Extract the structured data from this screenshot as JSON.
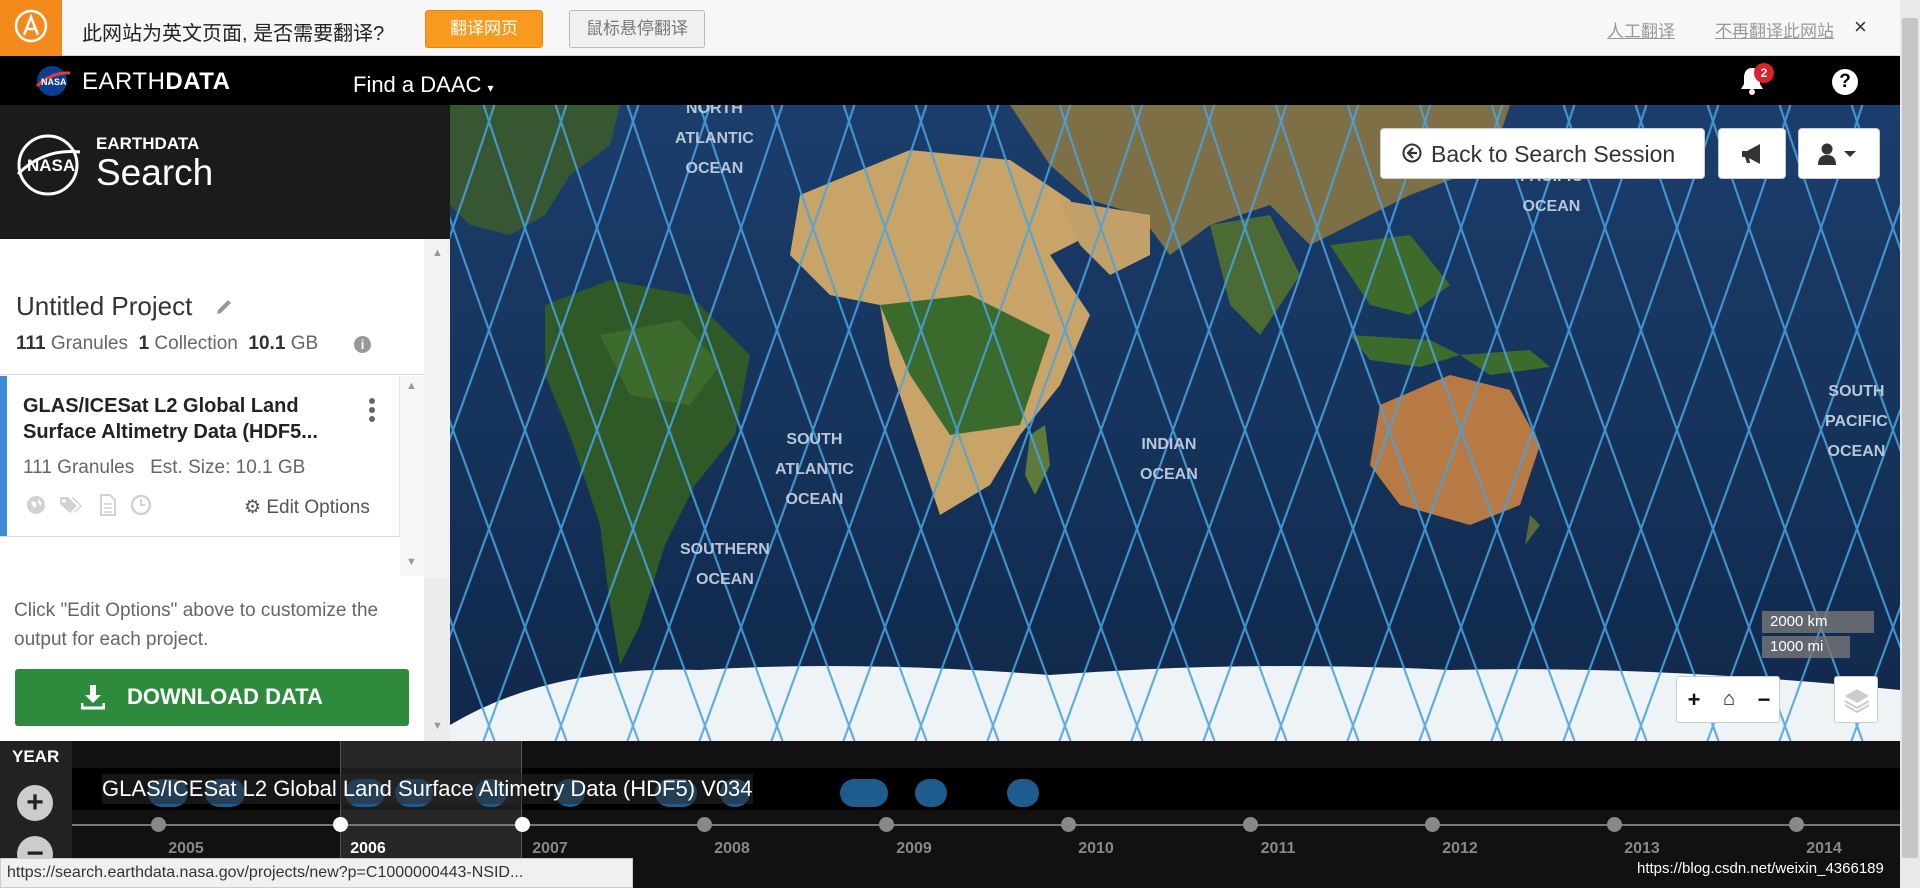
{
  "translate_bar": {
    "message": "此网站为英文页面, 是否需要翻译?",
    "translate_button": "翻译网页",
    "hover_button": "鼠标悬停翻译",
    "manual_link": "人工翻译",
    "never_link": "不再翻译此网站",
    "close": "×"
  },
  "nav": {
    "brand_light": "EARTH",
    "brand_bold": "DATA",
    "find_daac": "Find a DAAC",
    "find_daac_caret": "▾",
    "notification_count": "2",
    "help": "?"
  },
  "header": {
    "small": "EARTHDATA",
    "large": "Search"
  },
  "project": {
    "title": "Untitled Project",
    "granules_count": "111",
    "granules_label": "Granules",
    "collection_count": "1",
    "collection_label": "Collection",
    "size": "10.1",
    "size_unit": "GB"
  },
  "collection": {
    "title": "GLAS/ICESat L2 Global Land Surface Altimetry Data (HDF5...",
    "granules": "111 Granules",
    "est_size": "Est. Size: 10.1 GB",
    "edit_options": "Edit Options"
  },
  "hint": "Click \"Edit Options\" above to customize the output for each project.",
  "download_label": "DOWNLOAD DATA",
  "map": {
    "back_button": "Back to Search Session",
    "ocean_labels": [
      {
        "text": "NORTH\nATLANTIC\nOCEAN"
      },
      {
        "text": "SOUTH\nATLANTIC\nOCEAN"
      },
      {
        "text": "INDIAN\nOCEAN"
      },
      {
        "text": "SOUTHERN\nOCEAN"
      },
      {
        "text": "NORTH\nPACIFIC\nOCEAN"
      },
      {
        "text": "SOUTH\nPACIFIC\nOCEAN"
      }
    ],
    "scale_km": "2000 km",
    "scale_mi": "1000 mi",
    "zoom_in": "+",
    "home": "⌂",
    "zoom_out": "−"
  },
  "timeline": {
    "zoom_label": "YEAR",
    "zoom_in": "+",
    "zoom_out": "−",
    "collection_title": "GLAS/ICESat L2 Global Land Surface Altimetry Data (HDF5) V034",
    "years": [
      "2005",
      "2006",
      "2007",
      "2008",
      "2009",
      "2010",
      "2011",
      "2012",
      "2013",
      "2014"
    ],
    "selected_year": "2006"
  },
  "status_url": "https://search.earthdata.nasa.gov/projects/new?p=C1000000443-NSID...",
  "watermark": "https://blog.csdn.net/weixin_4366189",
  "colors": {
    "translate_orange": "#f79a1e",
    "accent_blue": "#3c8dd8",
    "download_green": "#2e8b3e",
    "badge_red": "#d9232e",
    "orbit_blue": "#4aa3e0"
  }
}
